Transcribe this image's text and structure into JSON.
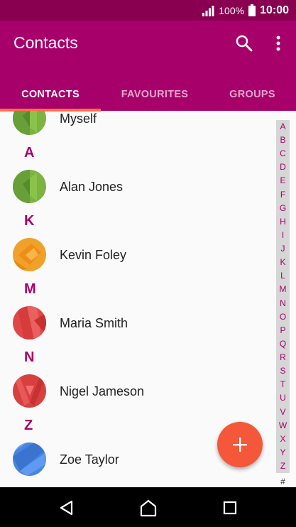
{
  "status": {
    "battery_pct": "100%",
    "time": "10:00"
  },
  "app": {
    "title": "Contacts"
  },
  "tabs": [
    {
      "label": "CONTACTS",
      "active": true
    },
    {
      "label": "FAVOURITES",
      "active": false
    },
    {
      "label": "GROUPS",
      "active": false
    }
  ],
  "contacts": {
    "myself": "Myself",
    "sections": [
      {
        "letter": "A",
        "name": "Alan Jones",
        "avatar_color": "#7cb342"
      },
      {
        "letter": "K",
        "name": "Kevin Foley",
        "avatar_color": "#f0a12a"
      },
      {
        "letter": "M",
        "name": "Maria Smith",
        "avatar_color": "#e04848"
      },
      {
        "letter": "N",
        "name": "Nigel Jameson",
        "avatar_color": "#d84040"
      },
      {
        "letter": "Z",
        "name": "Zoe Taylor",
        "avatar_color": "#4a86e0"
      }
    ]
  },
  "index": [
    "A",
    "B",
    "C",
    "D",
    "E",
    "F",
    "G",
    "H",
    "I",
    "J",
    "K",
    "L",
    "M",
    "N",
    "O",
    "P",
    "Q",
    "R",
    "S",
    "T",
    "U",
    "V",
    "W",
    "X",
    "Y",
    "Z"
  ],
  "index_hash": "#",
  "colors": {
    "primary": "#a8006b",
    "status": "#8a0050",
    "accent": "#f4573a",
    "indicator": "#ff7043"
  }
}
